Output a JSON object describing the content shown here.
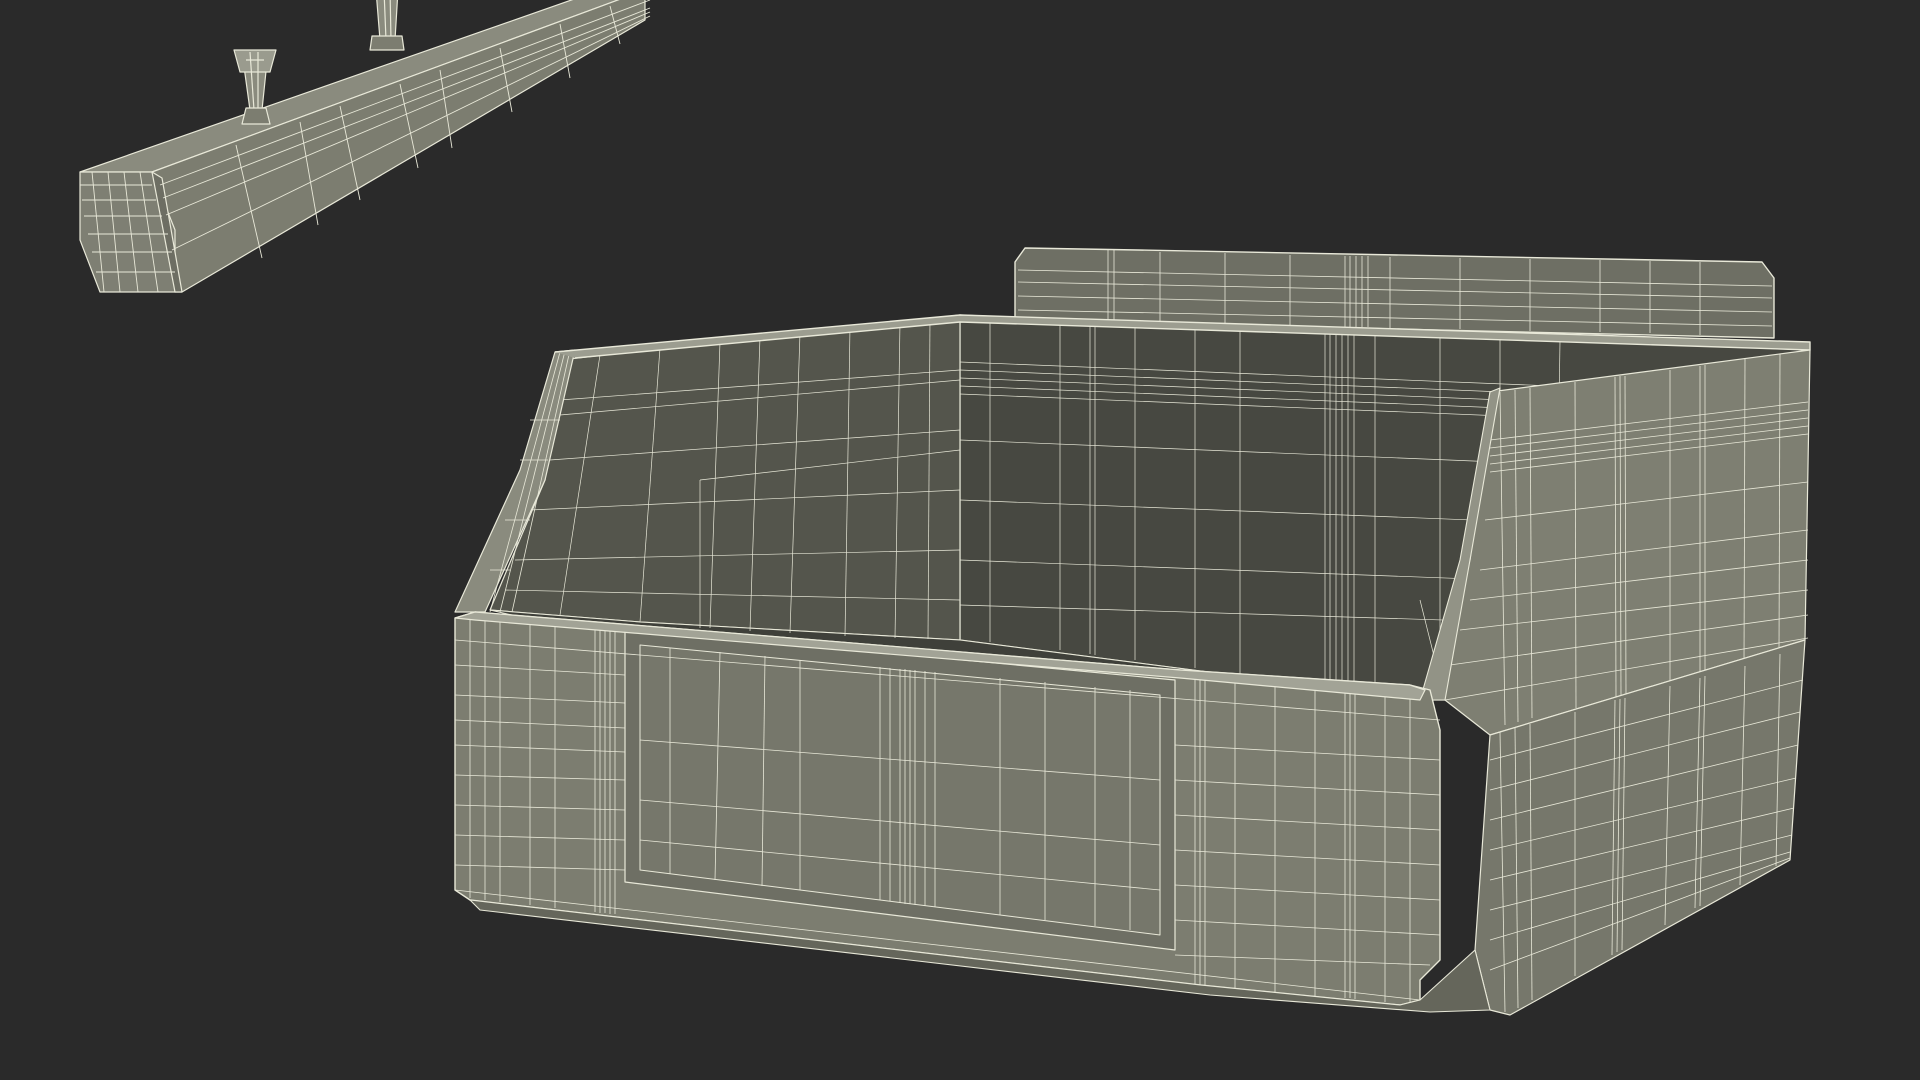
{
  "scene": {
    "background_color": "#2a2a2a",
    "wire_color": "#e8e8d8",
    "surface_color": "#7c7d70",
    "surface_light": "#8a8b7e",
    "surface_dark": "#5e5f55",
    "interior_color": "#4c4d45",
    "interior_dark": "#3e3f38",
    "objects": [
      "louvered-rail-with-pegs",
      "open-front-storage-bin"
    ]
  }
}
